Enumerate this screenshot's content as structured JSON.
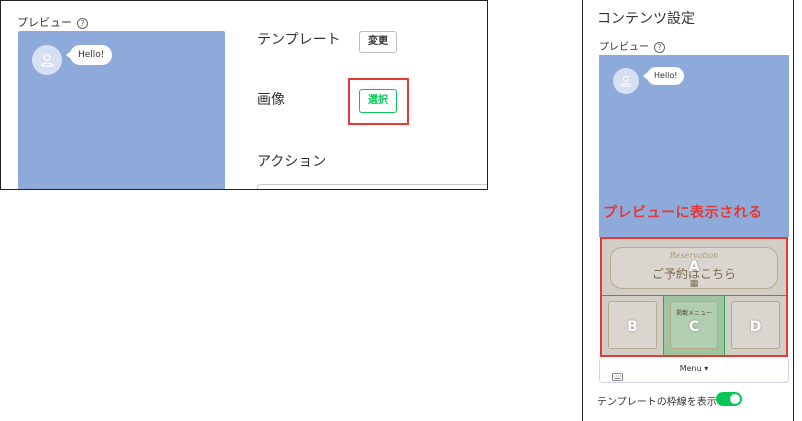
{
  "left": {
    "preview_label": "プレビュー",
    "bubble_text": "Hello!",
    "template_label": "テンプレート",
    "change_button": "変更",
    "image_label": "画像",
    "select_button": "選択",
    "action_label": "アクション"
  },
  "right": {
    "title": "コンテンツ設定",
    "preview_label": "プレビュー",
    "bubble_text": "Hello!",
    "caption": "プレビューに表示される",
    "menu": {
      "reservation_en": "Reservation",
      "reservation_jp": "ご予約はこちら",
      "c_menu_text": "掲載メニュー",
      "cells": [
        "A",
        "B",
        "C",
        "D"
      ]
    },
    "chatbar_menu_label": "Menu ▾",
    "toggle_label": "テンプレートの枠線を表示",
    "toggle_on": true
  },
  "colors": {
    "accent_green": "#06c755",
    "highlight_red": "#e53935",
    "preview_blue": "#8eaadb"
  },
  "icons": [
    "help-icon",
    "user-avatar-icon",
    "keyboard-icon",
    "toggle-switch"
  ]
}
